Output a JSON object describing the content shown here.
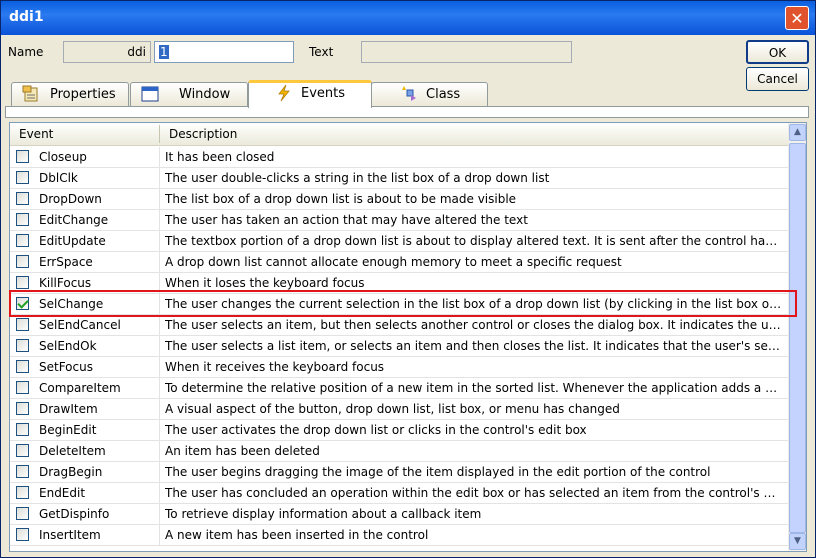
{
  "window": {
    "title": "ddi1",
    "close_glyph": "✕"
  },
  "form": {
    "name_label": "Name",
    "name_prefix": "ddi",
    "name_value": "1",
    "text_label": "Text",
    "text_value": ""
  },
  "buttons": {
    "ok": "OK",
    "cancel": "Cancel"
  },
  "tabs": [
    {
      "label": "Properties",
      "icon": "properties-icon"
    },
    {
      "label": "Window",
      "icon": "window-icon"
    },
    {
      "label": "Events",
      "icon": "lightning-icon",
      "active": true
    },
    {
      "label": "Class",
      "icon": "class-icon"
    }
  ],
  "list": {
    "columns": [
      "Event",
      "Description"
    ],
    "rows": [
      {
        "event": "Closeup",
        "description": "It has been closed",
        "checked": false
      },
      {
        "event": "DblClk",
        "description": "The user double-clicks a string in the list box of a drop down list",
        "checked": false
      },
      {
        "event": "DropDown",
        "description": "The list box of a drop down list is about to be made visible",
        "checked": false
      },
      {
        "event": "EditChange",
        "description": "The user has taken an action that may have altered the text",
        "checked": false
      },
      {
        "event": "EditUpdate",
        "description": "The textbox portion of a drop down list is about to display altered text. It is sent after the control has formatted th...",
        "checked": false
      },
      {
        "event": "ErrSpace",
        "description": "A drop down list cannot allocate enough memory to meet a specific request",
        "checked": false
      },
      {
        "event": "KillFocus",
        "description": "When it loses the keyboard focus",
        "checked": false
      },
      {
        "event": "SelChange",
        "description": "The user changes the current selection in the list box of a drop down list (by clicking in the list box or by using th...",
        "checked": true
      },
      {
        "event": "SelEndCancel",
        "description": "The user selects an item, but then selects another control or closes the dialog box. It indicates the user's initial s...",
        "checked": false
      },
      {
        "event": "SelEndOk",
        "description": "The user selects a list item, or selects an item and then closes the list. It indicates that the user's selection is to b...",
        "checked": false
      },
      {
        "event": "SetFocus",
        "description": "When it receives the keyboard focus",
        "checked": false
      },
      {
        "event": "CompareItem",
        "description": "To determine the relative position of a new item in the sorted list. Whenever the application adds a new item (C...",
        "checked": false
      },
      {
        "event": "DrawItem",
        "description": "A visual aspect of the button, drop down list, list box, or menu has changed",
        "checked": false
      },
      {
        "event": "BeginEdit",
        "description": "The user activates the drop down list or clicks in the control's edit box",
        "checked": false
      },
      {
        "event": "DeleteItem",
        "description": "An item has been deleted",
        "checked": false
      },
      {
        "event": "DragBegin",
        "description": "The user begins dragging the image of the item displayed in the edit portion of the control",
        "checked": false
      },
      {
        "event": "EndEdit",
        "description": "The user has concluded an operation within the edit box or has selected an item from the control's drop-down list",
        "checked": false
      },
      {
        "event": "GetDispinfo",
        "description": "To retrieve display information about a callback item",
        "checked": false
      },
      {
        "event": "InsertItem",
        "description": "A new item has been inserted in the control",
        "checked": false
      }
    ]
  },
  "colors": {
    "highlight": "#e0161a",
    "titlebar": "#0a5fe0",
    "active_tab_accent": "#ffc83c"
  }
}
